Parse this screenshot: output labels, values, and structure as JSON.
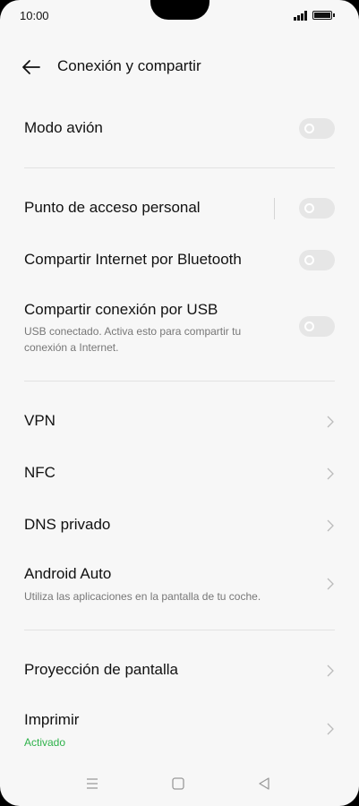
{
  "status": {
    "time": "10:00"
  },
  "header": {
    "title": "Conexión y compartir"
  },
  "rows": {
    "airplane": {
      "label": "Modo avión"
    },
    "hotspot": {
      "label": "Punto de acceso personal"
    },
    "bluetooth": {
      "label": "Compartir Internet por Bluetooth"
    },
    "usb": {
      "label": "Compartir conexión por USB",
      "sub": "USB conectado. Activa esto para compartir tu conexión a Internet."
    },
    "vpn": {
      "label": "VPN"
    },
    "nfc": {
      "label": "NFC"
    },
    "dns": {
      "label": "DNS privado"
    },
    "auto": {
      "label": "Android Auto",
      "sub": "Utiliza las aplicaciones en la pantalla de tu coche."
    },
    "cast": {
      "label": "Proyección de pantalla"
    },
    "print": {
      "label": "Imprimir",
      "sub": "Activado"
    }
  },
  "colors": {
    "accent_green": "#2fb24b",
    "toggle_off": "#e6e6e6",
    "background": "#f7f7f7"
  },
  "icons": {
    "back": "arrow-left-icon",
    "chevron": "chevron-right-icon",
    "nav": [
      "menu-icon",
      "home-square-icon",
      "back-triangle-icon"
    ]
  }
}
